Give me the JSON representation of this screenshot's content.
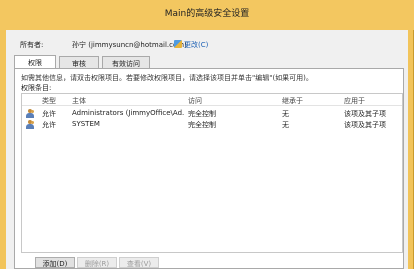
{
  "window": {
    "title": "Main的高级安全设置"
  },
  "owner": {
    "label": "所有者:",
    "value": "孙宁 (jimmysuncn@hotmail.com)",
    "change_link": "更改(C)"
  },
  "tabs": [
    {
      "label": "权限",
      "active": true
    },
    {
      "label": "审核",
      "active": false
    },
    {
      "label": "有效访问",
      "active": false
    }
  ],
  "panel": {
    "hint": "如需其他信息，请双击权限项目。若要修改权限项目，请选择该项目并单击\"编辑\"(如果可用)。",
    "entries_label": "权限条目:"
  },
  "list": {
    "columns": {
      "type": "类型",
      "principal": "主体",
      "access": "访问",
      "inherited_from": "继承于",
      "applies_to": "应用于"
    },
    "rows": [
      {
        "type": "允许",
        "principal": "Administrators (JimmyOffice\\Ad...",
        "access": "完全控制",
        "inherited_from": "无",
        "applies_to": "该项及其子项"
      },
      {
        "type": "允许",
        "principal": "SYSTEM",
        "access": "完全控制",
        "inherited_from": "无",
        "applies_to": "该项及其子项"
      }
    ]
  },
  "buttons": {
    "add": "添加(D)",
    "remove": "删除(R)",
    "view": "查看(V)"
  }
}
